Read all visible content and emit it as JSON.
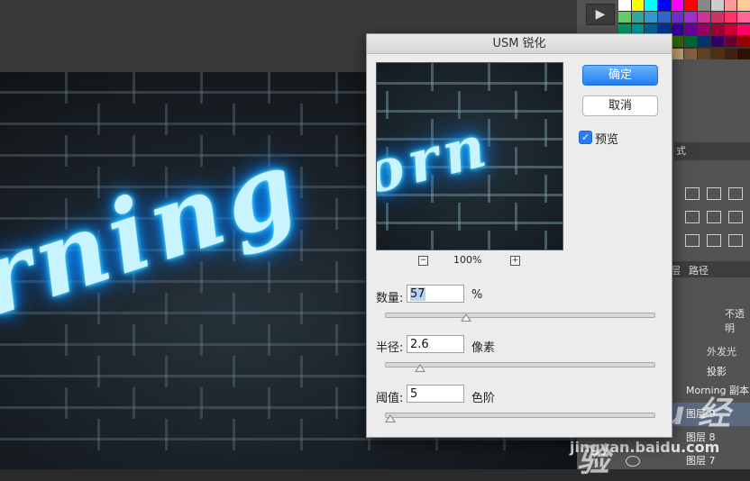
{
  "dialog": {
    "title": "USM 锐化",
    "ok_label": "确定",
    "cancel_label": "取消",
    "preview_label": "预览",
    "preview_checked": true,
    "zoom_level": "100%",
    "zoom_out_symbol": "−",
    "zoom_in_symbol": "+",
    "params": {
      "amount": {
        "label": "数量:",
        "value": "57",
        "unit": "%"
      },
      "radius": {
        "label": "半径:",
        "value": "2.6",
        "unit": "像素"
      },
      "threshold": {
        "label": "阈值:",
        "value": "5",
        "unit": "色阶"
      }
    },
    "accent_color": "#1f7df3"
  },
  "canvas": {
    "neon_text": "rning",
    "preview_neon_text": "orn"
  },
  "right_panel": {
    "tab_label": "式",
    "layers_tab": "层",
    "paths_tab": "路径",
    "opacity_label": "不透明",
    "fx_name": "外发光",
    "shadow_name": "投影",
    "layers": [
      {
        "name": "Morning 副本"
      },
      {
        "name": "图层 9"
      },
      {
        "name": "图层 8"
      },
      {
        "name": "图层 7"
      }
    ]
  },
  "watermark": {
    "logo_text": "Baidu 经验",
    "url": "jingyan.baidu.com"
  }
}
